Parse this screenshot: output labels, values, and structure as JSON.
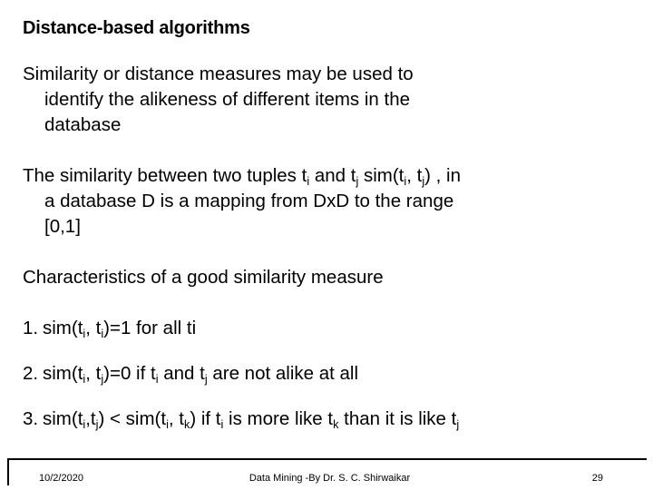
{
  "slide": {
    "title": "Distance-based algorithms",
    "page_number": "29"
  },
  "body": {
    "paragraph1": {
      "line1": "Similarity or distance measures may be used to",
      "line2": "identify the alikeness of different items in the",
      "line3": "database"
    },
    "paragraph2": {
      "line1_a": "The similarity between two tuples t",
      "line1_sub1": "i",
      "line1_b": " and t",
      "line1_sub2": "j",
      "line1_c": " sim(t",
      "line1_sub3": "i",
      "line1_d": ", t",
      "line1_sub4": "j",
      "line1_e": ") , in",
      "line2": "a database D is a mapping from DxD to the range",
      "line3": "[0,1]"
    },
    "paragraph3": {
      "text": "Characteristics of a good similarity measure"
    },
    "list": [
      {
        "number": "1.",
        "a": "sim(t",
        "sub1": "i",
        "b": ", t",
        "sub2": "i",
        "c": ")=1  for all ti"
      },
      {
        "number": "2.",
        "a": "sim(t",
        "sub1": "i",
        "b": ", t",
        "sub2": "j",
        "c": ")=0 if t",
        "sub3": "i",
        "d": " and t",
        "sub4": "j",
        "e": " are not alike at all"
      },
      {
        "number": "3.",
        "a": "sim(t",
        "sub1": "i",
        "b": ",t",
        "sub2": "j",
        "c": ") < sim(t",
        "sub3": "i",
        "d": ", t",
        "sub4": "k",
        "e": ") if t",
        "sub5": "i",
        "f": " is more like t",
        "sub6": "k",
        "g": " than it is like t",
        "sub7": "j"
      }
    ]
  },
  "footer": {
    "date": "10/2/2020",
    "center": "Data Mining -By Dr. S. C. Shirwaikar",
    "page": "29"
  },
  "colors": {
    "background": "#ffffff",
    "text": "#000000",
    "footer_rule": "#000000"
  }
}
